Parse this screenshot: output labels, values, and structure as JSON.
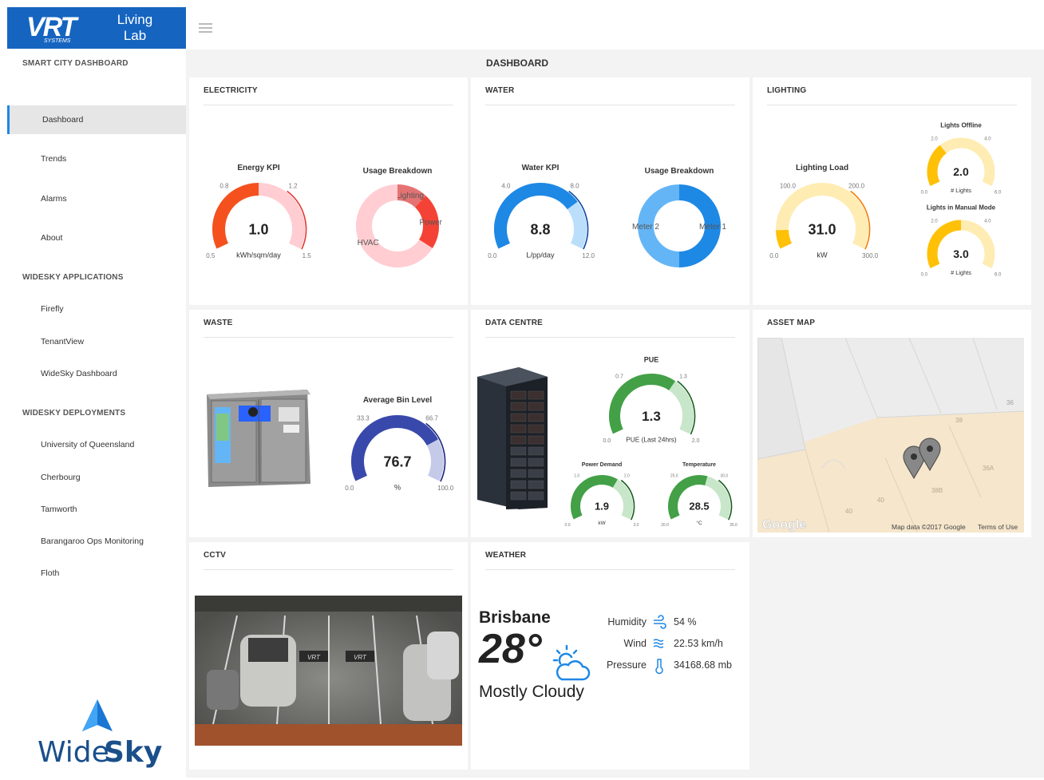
{
  "brand": {
    "logo_text": "VRT",
    "logo_sub": "SYSTEMS",
    "logo_side": "Living Lab",
    "app_name": "SMART CITY DASHBOARD",
    "footer_logo_a": "Wide",
    "footer_logo_b": "Sky"
  },
  "sidebar": {
    "items": [
      {
        "label": "Dashboard"
      },
      {
        "label": "Trends"
      },
      {
        "label": "Alarms"
      },
      {
        "label": "About"
      }
    ],
    "section_apps": "WIDESKY APPLICATIONS",
    "apps": [
      {
        "label": "Firefly"
      },
      {
        "label": "TenantView"
      },
      {
        "label": "WideSky Dashboard"
      }
    ],
    "section_deploy": "WIDESKY DEPLOYMENTS",
    "deployments": [
      {
        "label": "University of Queensland"
      },
      {
        "label": "Cherbourg"
      },
      {
        "label": "Tamworth"
      },
      {
        "label": "Barangaroo Ops Monitoring"
      },
      {
        "label": "Floth"
      }
    ]
  },
  "page": {
    "title": "DASHBOARD"
  },
  "cards": {
    "electricity": {
      "title": "ELECTRICITY",
      "kpi": {
        "label": "Energy KPI",
        "value": "1.0",
        "unit": "kWh/sqm/day",
        "min": "0.5",
        "max": "1.5",
        "t1": "0.8",
        "t2": "1.2",
        "fraction": 0.5
      },
      "breakdown": {
        "label": "Usage Breakdown",
        "slices": [
          {
            "name": "Lighting",
            "share": 0.12
          },
          {
            "name": "Power",
            "share": 0.22
          },
          {
            "name": "HVAC",
            "share": 0.66
          }
        ]
      }
    },
    "water": {
      "title": "WATER",
      "kpi": {
        "label": "Water KPI",
        "value": "8.8",
        "unit": "L/pp/day",
        "min": "0.0",
        "max": "12.0",
        "t1": "4.0",
        "t2": "8.0",
        "fraction": 0.733
      },
      "breakdown": {
        "label": "Usage Breakdown",
        "slices": [
          {
            "name": "Meter 1",
            "share": 0.5
          },
          {
            "name": "Meter 2",
            "share": 0.5
          }
        ]
      }
    },
    "lighting": {
      "title": "LIGHTING",
      "load": {
        "label": "Lighting Load",
        "value": "31.0",
        "unit": "kW",
        "min": "0.0",
        "max": "300.0",
        "t1": "100.0",
        "t2": "200.0",
        "fraction": 0.103
      },
      "offline": {
        "label": "Lights Offline",
        "value": "2.0",
        "unit": "# Lights",
        "min": "0.0",
        "max": "6.0",
        "t1": "2.0",
        "t2": "4.0",
        "fraction": 0.333
      },
      "manual": {
        "label": "Lights in Manual Mode",
        "value": "3.0",
        "unit": "# Lights",
        "min": "0.0",
        "max": "6.0",
        "t1": "2.0",
        "t2": "4.0",
        "fraction": 0.5
      }
    },
    "waste": {
      "title": "WASTE",
      "bin": {
        "label": "Average Bin Level",
        "value": "76.7",
        "unit": "%",
        "min": "0.0",
        "max": "100.0",
        "t1": "33.3",
        "t2": "66.7",
        "fraction": 0.767
      }
    },
    "datacentre": {
      "title": "DATA CENTRE",
      "pue": {
        "label": "PUE",
        "value": "1.3",
        "unit": "PUE (Last 24hrs)",
        "min": "0.0",
        "max": "2.0",
        "t1": "0.7",
        "t2": "1.3",
        "fraction": 0.65
      },
      "power": {
        "label": "Power Demand",
        "value": "1.9",
        "unit": "kW",
        "min": "0.0",
        "max": "3.0",
        "t1": "1.0",
        "t2": "2.0",
        "fraction": 0.633
      },
      "temp": {
        "label": "Temperature",
        "value": "28.5",
        "unit": "°C",
        "min": "20.0",
        "max": "35.0",
        "t1": "25.0",
        "t2": "30.0",
        "fraction": 0.567
      }
    },
    "assetmap": {
      "title": "ASSET MAP",
      "attribution": "Map data ©2017 Google",
      "terms": "Terms of Use",
      "google": "Google",
      "labels": [
        "36",
        "38",
        "36A",
        "38B",
        "40",
        "40"
      ]
    },
    "cctv": {
      "title": "CCTV",
      "bay_marks": [
        "VRT",
        "VRT"
      ]
    },
    "weather": {
      "title": "WEATHER",
      "city": "Brisbane",
      "temperature": "28°",
      "condition": "Mostly Cloudy",
      "humidity_label": "Humidity",
      "humidity": "54 %",
      "wind_label": "Wind",
      "wind": "22.53 km/h",
      "pressure_label": "Pressure",
      "pressure": "34168.68 mb"
    }
  },
  "colors": {
    "brand_blue": "#1565c0",
    "active_border": "#1e88e5",
    "electric_red": "#f4511e",
    "water_blue": "#1e88e5",
    "lighting_yellow": "#ffc107",
    "waste_indigo": "#3949ab",
    "dc_green": "#43a047"
  }
}
